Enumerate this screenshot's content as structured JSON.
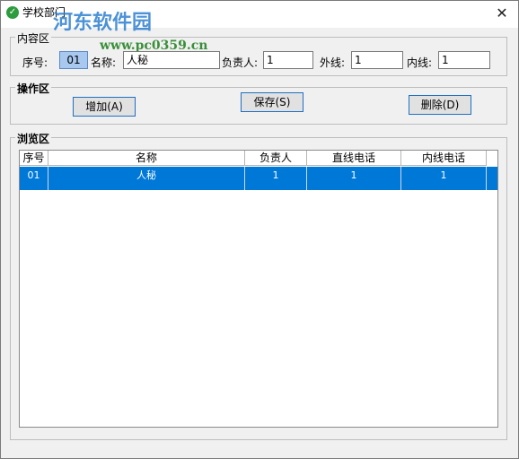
{
  "window": {
    "title": "学校部门",
    "watermark": "河东软件园",
    "watermark_url": "www.pc0359.cn",
    "close_glyph": "✕",
    "icon": "check-circle-icon"
  },
  "content_group": {
    "title": "内容区",
    "index_label": "序号:",
    "index_value": "01",
    "name_label": "名称:",
    "name_value": "人秘",
    "owner_label": "负责人:",
    "owner_value": "1",
    "external_label": "外线:",
    "external_value": "1",
    "internal_label": "内线:",
    "internal_value": "1"
  },
  "actions_group": {
    "title": "操作区",
    "add_label": "增加(A)",
    "save_label": "保存(S)",
    "delete_label": "删除(D)"
  },
  "browse_group": {
    "title": "浏览区",
    "columns": [
      "序号",
      "名称",
      "负责人",
      "直线电话",
      "内线电话"
    ],
    "rows": [
      [
        "01",
        "人秘",
        "1",
        "1",
        "1"
      ]
    ],
    "selected_color": "#0078d7"
  }
}
